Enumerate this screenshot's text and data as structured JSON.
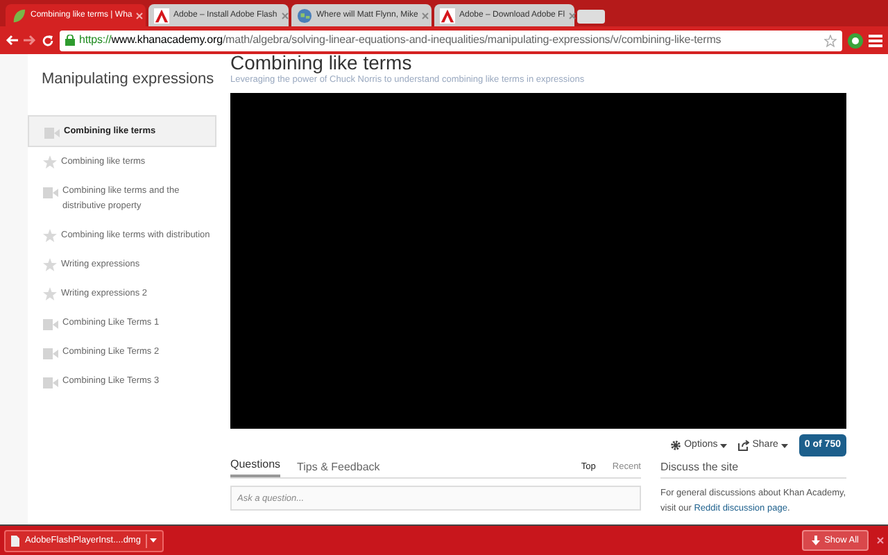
{
  "browser": {
    "tabs": [
      {
        "title": "Combining like terms | Wha",
        "kind": "leaf",
        "selected": true
      },
      {
        "title": "Adobe – Install Adobe Flash",
        "kind": "adobe",
        "selected": false
      },
      {
        "title": "Where will Matt Flynn, Mike",
        "kind": "globe",
        "selected": false
      },
      {
        "title": "Adobe – Download Adobe Fl",
        "kind": "adobe",
        "selected": false
      }
    ],
    "url": {
      "scheme": "https://",
      "host": "www.khanacademy.org",
      "path": "/math/algebra/solving-linear-equations-and-inequalities/manipulating-expressions/v/combining-like-terms"
    }
  },
  "sidebar": {
    "title": "Manipulating expressions",
    "items": [
      {
        "label": "Combining like terms",
        "kind": "video",
        "selected": true
      },
      {
        "label": "Combining like terms",
        "kind": "exercise",
        "selected": false
      },
      {
        "label": "Combining like terms and the distributive property",
        "kind": "video",
        "selected": false
      },
      {
        "label": "Combining like terms with distribution",
        "kind": "exercise",
        "selected": false
      },
      {
        "label": "Writing expressions",
        "kind": "exercise",
        "selected": false
      },
      {
        "label": "Writing expressions 2",
        "kind": "exercise",
        "selected": false
      },
      {
        "label": "Combining Like Terms 1",
        "kind": "video",
        "selected": false
      },
      {
        "label": "Combining Like Terms 2",
        "kind": "video",
        "selected": false
      },
      {
        "label": "Combining Like Terms 3",
        "kind": "video",
        "selected": false
      }
    ]
  },
  "video": {
    "title": "Combining like terms",
    "subtitle": "Leveraging the power of Chuck Norris to understand combining like terms in expressions",
    "options": "Options",
    "share": "Share",
    "points": "0 of 750"
  },
  "discussion": {
    "tabs": [
      {
        "label": "Questions",
        "selected": true
      },
      {
        "label": "Tips & Feedback",
        "selected": false
      }
    ],
    "sort": [
      {
        "label": "Top",
        "selected": true
      },
      {
        "label": "Recent",
        "selected": false
      }
    ],
    "placeholder": "Ask a question..."
  },
  "discuss_site": {
    "title": "Discuss the site",
    "text": "For general discussions about Khan Academy, visit our",
    "link": "Reddit discussion page",
    "end": "."
  },
  "downloads": {
    "file": "AdobeFlashPlayerInst....dmg",
    "show_all": "Show All"
  }
}
